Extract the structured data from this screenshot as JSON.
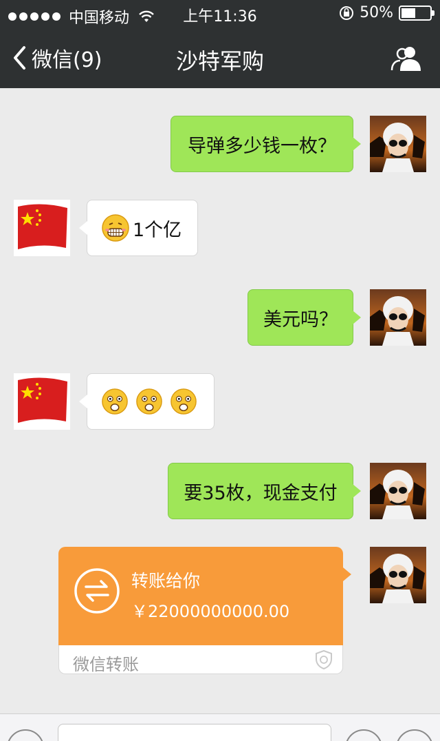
{
  "status_bar": {
    "carrier": "中国移动",
    "time": "上午11:36",
    "battery": "50%",
    "battery_level": 0.5
  },
  "nav": {
    "back_label": "微信(9)",
    "title": "沙特军购",
    "right_icon": "contacts-icon"
  },
  "messages": [
    {
      "from": "me",
      "text": "导弹多少钱一枚？",
      "avatar": "saudi-avatar"
    },
    {
      "from": "them",
      "text": "1个亿",
      "emoji": [
        "grin-emoji"
      ],
      "avatar": "china-flag-avatar"
    },
    {
      "from": "me",
      "text": "美元吗？",
      "avatar": "saudi-avatar"
    },
    {
      "from": "them",
      "text": "",
      "emoji": [
        "shocked-emoji",
        "shocked-emoji",
        "shocked-emoji"
      ],
      "avatar": "china-flag-avatar"
    },
    {
      "from": "me",
      "text": "要35枚，现金支付",
      "avatar": "saudi-avatar"
    }
  ],
  "transfer": {
    "label": "转账给你",
    "amount": "￥22000000000.00",
    "brand": "微信转账",
    "color": "#f89b3a"
  },
  "colors": {
    "nav_bg": "#2e3132",
    "chat_bg": "#ebebeb",
    "my_bubble": "#9fe658",
    "their_bubble": "#ffffff"
  }
}
